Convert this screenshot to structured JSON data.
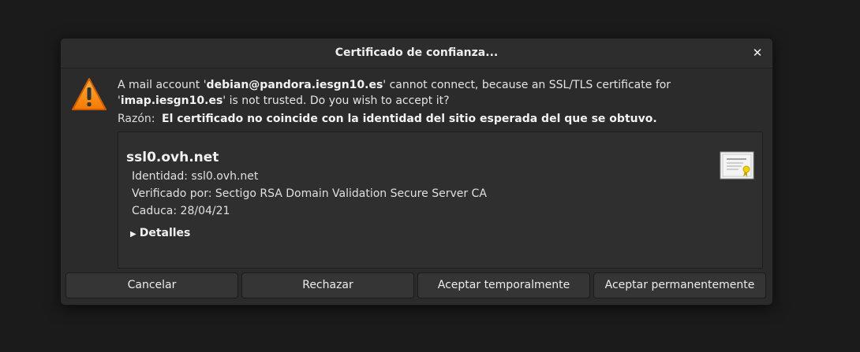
{
  "dialog": {
    "title": "Certificado de confianza...",
    "close_glyph": "✕",
    "warning_icon": "warning-triangle-icon"
  },
  "message": {
    "part1": "A mail account '",
    "account": "debian@pandora.iesgn10.es",
    "part2": "' cannot connect, because an SSL/TLS certificate for '",
    "host": "imap.iesgn10.es",
    "part3": "' is not trusted. Do you wish to accept it?"
  },
  "reason": {
    "label": "Razón:",
    "value": "El certificado no coincide con la identidad del sitio esperada del que se obtuvo."
  },
  "certificate": {
    "name": "ssl0.ovh.net",
    "identity": "Identidad: ssl0.ovh.net",
    "verified_by": "Verificado por: Sectigo RSA Domain Validation Secure Server CA",
    "expires": "Caduca: 28/04/21",
    "details_label": "Detalles",
    "icon": "certificate-icon"
  },
  "buttons": {
    "cancel": "Cancelar",
    "reject": "Rechazar",
    "accept_temp": "Aceptar temporalmente",
    "accept_perm": "Aceptar permanentemente"
  },
  "colors": {
    "warning": "#f57900",
    "background": "#2b2b2b"
  }
}
